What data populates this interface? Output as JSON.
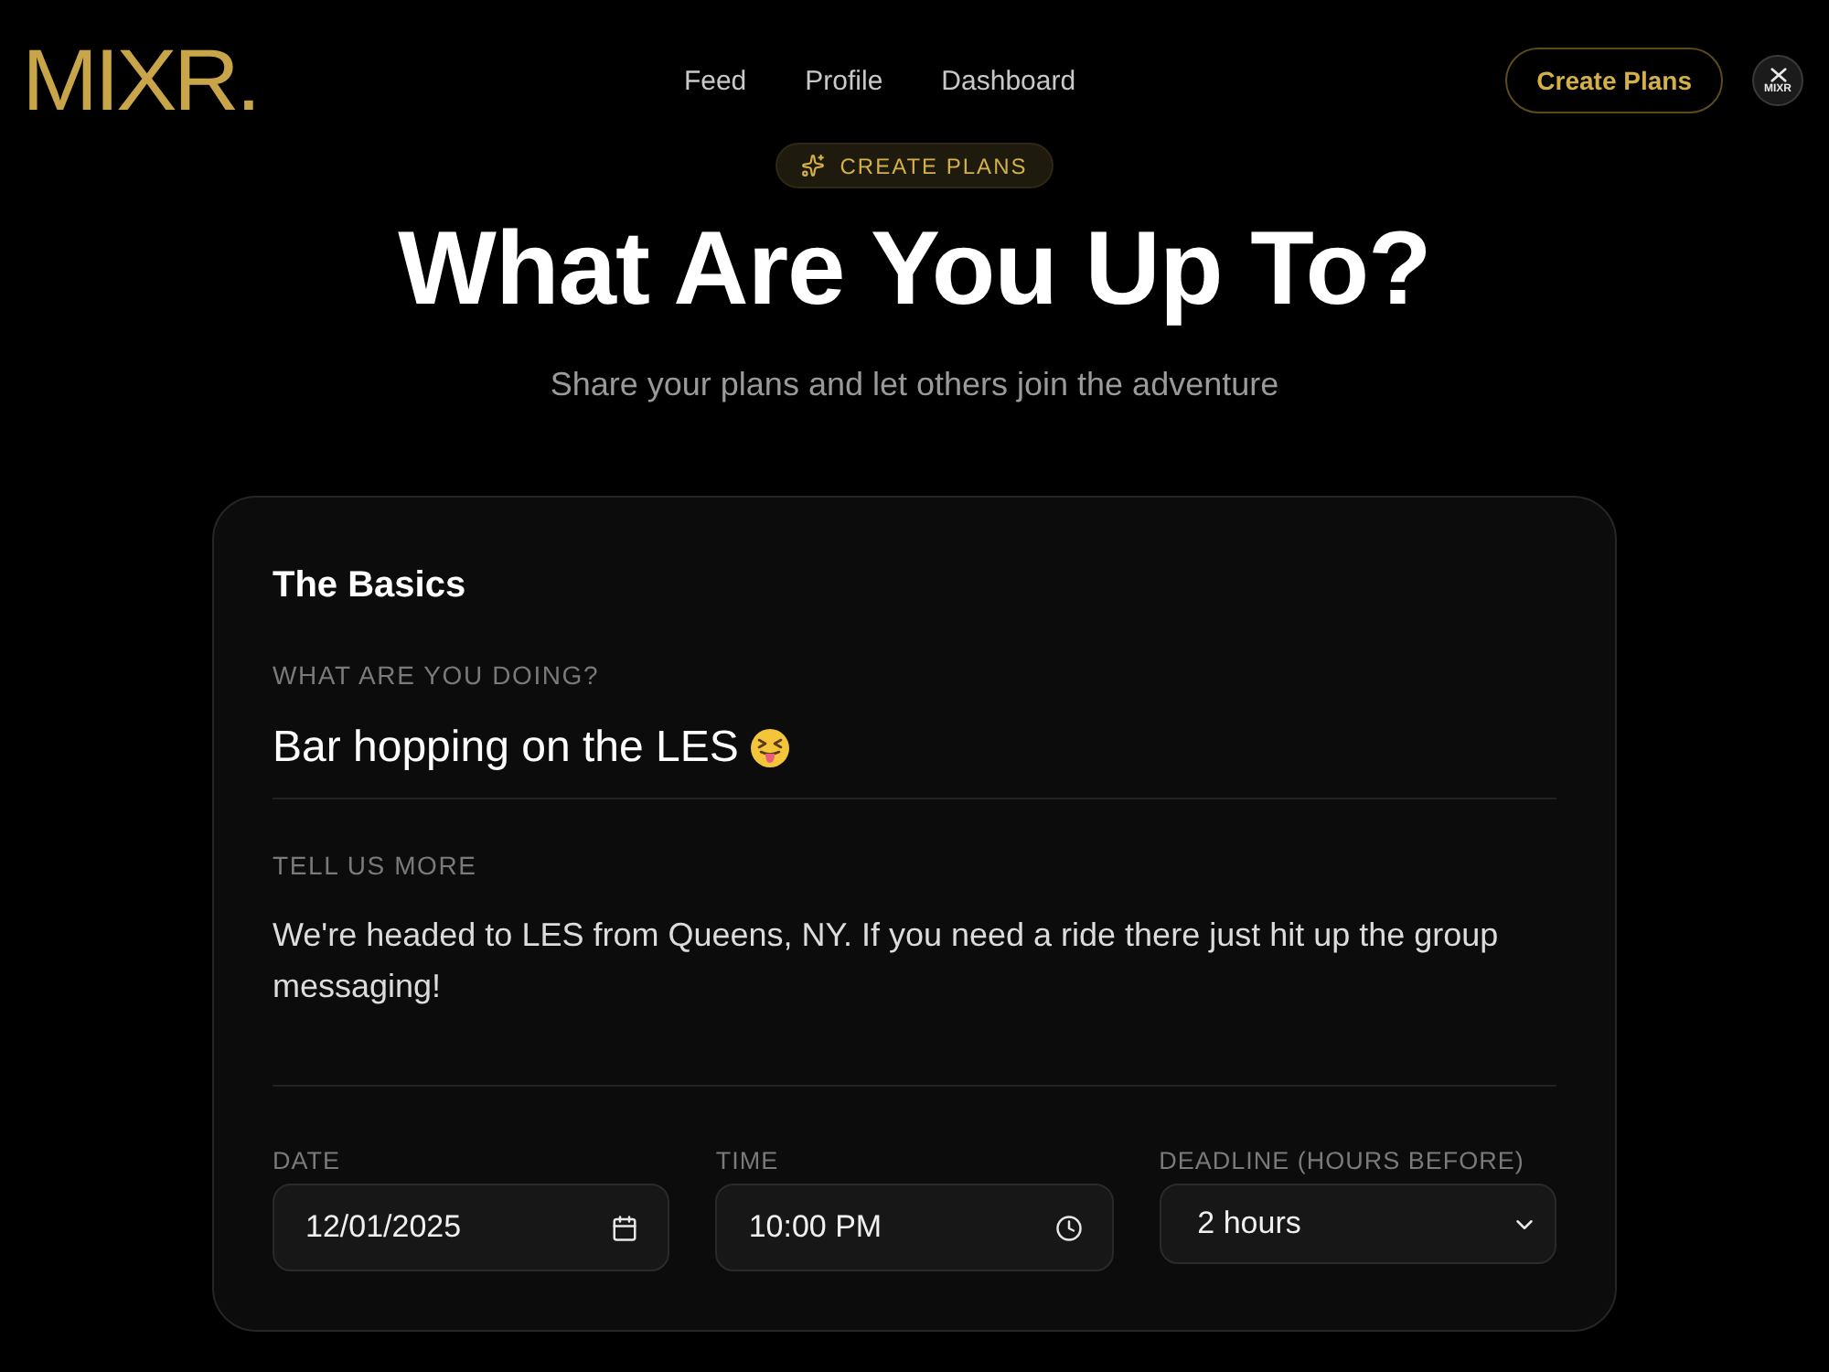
{
  "header": {
    "logo": "MIXR.",
    "nav": [
      {
        "label": "Feed"
      },
      {
        "label": "Profile"
      },
      {
        "label": "Dashboard"
      }
    ],
    "cta": "Create Plans",
    "avatar": "MIXR"
  },
  "hero": {
    "badge": "CREATE PLANS",
    "title": "What Are You Up To?",
    "subtitle": "Share your plans and let others join the adventure"
  },
  "form": {
    "section_title": "The Basics",
    "fields": [
      {
        "kind": "text",
        "label": "WHAT ARE YOU DOING?",
        "value": "Bar hopping on the LES"
      },
      {
        "kind": "textarea",
        "label": "TELL US MORE",
        "value": "We're headed to LES from Queens, NY. If you need a ride there just hit up the group messaging!"
      }
    ],
    "schedule": [
      {
        "kind": "date",
        "label": "DATE",
        "value": "12/01/2025"
      },
      {
        "kind": "time",
        "label": "TIME",
        "value": "10:00 PM"
      },
      {
        "kind": "select",
        "label": "DEADLINE (HOURS BEFORE)",
        "value": "2 hours"
      }
    ]
  }
}
